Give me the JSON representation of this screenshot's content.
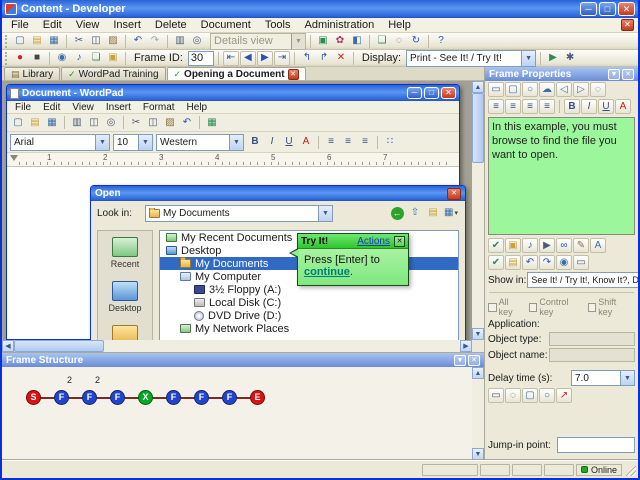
{
  "window": {
    "title": "Content - Developer"
  },
  "menubar": {
    "items": [
      "File",
      "Edit",
      "View",
      "Insert",
      "Delete",
      "Document",
      "Tools",
      "Administration",
      "Help"
    ]
  },
  "toolbar1": {
    "left": [
      {
        "name": "new-document-icon",
        "glyph": "▢",
        "color": "#3A6EA5"
      },
      {
        "name": "open-icon",
        "glyph": "▤",
        "color": "#C9A23A"
      },
      {
        "name": "save-icon",
        "glyph": "▦",
        "color": "#3A6EA5"
      },
      {
        "sep": true
      },
      {
        "name": "cut-icon",
        "glyph": "✂",
        "color": "#4A5A78"
      },
      {
        "name": "copy-icon",
        "glyph": "◫",
        "color": "#4A5A78"
      },
      {
        "name": "paste-icon",
        "glyph": "▨",
        "color": "#8A6D3B"
      },
      {
        "sep": true
      },
      {
        "name": "undo-icon",
        "glyph": "↶",
        "color": "#2A52BE"
      },
      {
        "name": "redo-icon",
        "glyph": "↷",
        "color": "#9AA4B8"
      },
      {
        "sep": true
      },
      {
        "name": "print-icon",
        "glyph": "▥",
        "color": "#4A5A78"
      },
      {
        "name": "preview-icon",
        "glyph": "◎",
        "color": "#4A5A78"
      }
    ],
    "details_view": "Details view",
    "right": [
      {
        "name": "properties-icon",
        "glyph": "▣",
        "color": "#2E8B57"
      },
      {
        "name": "color-palette-icon",
        "glyph": "✿",
        "color": "#B03060"
      },
      {
        "name": "insert-frame-icon",
        "glyph": "◧",
        "color": "#3A6EA5"
      },
      {
        "sep": true
      },
      {
        "name": "bubble-icon",
        "glyph": "❑",
        "color": "#2E8B57"
      },
      {
        "name": "magnifier-icon",
        "glyph": "◌",
        "color": "#4A5A78"
      },
      {
        "name": "refresh-icon",
        "glyph": "↻",
        "color": "#2A52BE"
      },
      {
        "sep": true
      },
      {
        "name": "help-icon",
        "glyph": "?",
        "color": "#2A52BE"
      }
    ]
  },
  "toolbar2": {
    "left": [
      {
        "name": "record-icon",
        "glyph": "●",
        "color": "#CC2222"
      },
      {
        "name": "stop-icon",
        "glyph": "■",
        "color": "#444444"
      },
      {
        "sep": true
      },
      {
        "name": "screenshot-icon",
        "glyph": "◉",
        "color": "#3A6EA5"
      },
      {
        "name": "sound-icon",
        "glyph": "♪",
        "color": "#2A52BE"
      },
      {
        "name": "text-bubble-icon",
        "glyph": "❏",
        "color": "#2E8B57"
      },
      {
        "name": "image-icon",
        "glyph": "▣",
        "color": "#C9A23A"
      },
      {
        "sep": true
      }
    ],
    "frame_id_label": "Frame ID:",
    "frame_id_value": "30",
    "nav": [
      {
        "name": "first-frame-button",
        "glyph": "⇤",
        "color": "#2A52BE"
      },
      {
        "name": "previous-frame-button",
        "glyph": "◀",
        "color": "#2A52BE"
      },
      {
        "name": "next-frame-button",
        "glyph": "▶",
        "color": "#2A52BE"
      },
      {
        "name": "last-frame-button",
        "glyph": "⇥",
        "color": "#2A52BE"
      }
    ],
    "mid": [
      {
        "name": "insert-frame-before-icon",
        "glyph": "↰",
        "color": "#2A52BE"
      },
      {
        "name": "insert-frame-after-icon",
        "glyph": "↱",
        "color": "#2A52BE"
      },
      {
        "name": "delete-frame-icon",
        "glyph": "✕",
        "color": "#CC2222"
      },
      {
        "sep": true
      }
    ],
    "display_label": "Display:",
    "display_value": "Print - See It! / Try It!",
    "right": [
      {
        "name": "play-preview-icon",
        "glyph": "▶",
        "color": "#2E8B57"
      },
      {
        "name": "settings-icon",
        "glyph": "✱",
        "color": "#4A5A78"
      }
    ]
  },
  "tabs": [
    {
      "label": "Library",
      "icon": "library"
    },
    {
      "label": "WordPad Training",
      "check": true
    },
    {
      "label": "Opening a Document",
      "check": true,
      "active": true,
      "close": true
    }
  ],
  "wordpad": {
    "title": "Document - WordPad",
    "menu": [
      "File",
      "Edit",
      "View",
      "Insert",
      "Format",
      "Help"
    ],
    "toolbar": [
      {
        "name": "new-document-icon",
        "glyph": "▢",
        "color": "#3A6EA5"
      },
      {
        "name": "open-icon",
        "glyph": "▤",
        "color": "#C9A23A"
      },
      {
        "name": "save-icon",
        "glyph": "▦",
        "color": "#3A6EA5"
      },
      {
        "sep": true
      },
      {
        "name": "print-icon",
        "glyph": "▥",
        "color": "#4A5A78"
      },
      {
        "name": "print-preview-icon",
        "glyph": "◫",
        "color": "#4A5A78"
      },
      {
        "name": "find-icon",
        "glyph": "◎",
        "color": "#4A5A78"
      },
      {
        "sep": true
      },
      {
        "name": "cut-icon",
        "glyph": "✂",
        "color": "#4A5A78"
      },
      {
        "name": "copy-icon",
        "glyph": "◫",
        "color": "#4A5A78"
      },
      {
        "name": "paste-icon",
        "glyph": "▨",
        "color": "#8A6D3B"
      },
      {
        "name": "undo-icon",
        "glyph": "↶",
        "color": "#2A52BE"
      },
      {
        "sep": true
      },
      {
        "name": "datetime-icon",
        "glyph": "▦",
        "color": "#2E8B57"
      }
    ],
    "font_name": "Arial",
    "font_size": "10",
    "font_script": "Western",
    "format_icons": [
      {
        "name": "bold-button",
        "glyph": "B",
        "bold": true
      },
      {
        "name": "italic-button",
        "glyph": "I",
        "italic": true
      },
      {
        "name": "underline-button",
        "glyph": "U",
        "underline": true
      },
      {
        "name": "font-color-icon",
        "glyph": "A",
        "color": "#CC2200"
      },
      {
        "sep": true
      },
      {
        "name": "align-left-icon",
        "glyph": "≡"
      },
      {
        "name": "align-center-icon",
        "glyph": "≡"
      },
      {
        "name": "align-right-icon",
        "glyph": "≡"
      },
      {
        "sep": true
      },
      {
        "name": "bullets-icon",
        "glyph": "∷",
        "color": "#2A52BE"
      }
    ],
    "ruler_numbers": [
      "1",
      "2",
      "3",
      "4",
      "5",
      "6",
      "7"
    ]
  },
  "open_dialog": {
    "title": "Open",
    "look_in_label": "Look in:",
    "look_in_value": "My Documents",
    "toolbar": [
      {
        "name": "back-icon",
        "glyph": "←",
        "circle": true
      },
      {
        "name": "up-folder-icon",
        "glyph": "⇧",
        "color": "#3A6EA5"
      },
      {
        "name": "new-folder-icon",
        "glyph": "▤",
        "color": "#C9A23A"
      },
      {
        "name": "views-icon",
        "glyph": "▦",
        "color": "#3A6EA5",
        "dropdown": true
      }
    ],
    "places": [
      {
        "label": "Recent",
        "icon": "recent"
      },
      {
        "label": "Desktop",
        "icon": "desktop"
      },
      {
        "label": "",
        "icon": "folder"
      }
    ],
    "tree": [
      {
        "label": "My Recent Documents",
        "depth": 0,
        "icon": "recent"
      },
      {
        "label": "Desktop",
        "depth": 0,
        "icon": "desktop"
      },
      {
        "label": "My Documents",
        "depth": 1,
        "icon": "folder",
        "selected": true
      },
      {
        "label": "My Computer",
        "depth": 1,
        "icon": "computer"
      },
      {
        "label": "3½ Floppy (A:)",
        "depth": 2,
        "icon": "floppy"
      },
      {
        "label": "Local Disk (C:)",
        "depth": 2,
        "icon": "disk"
      },
      {
        "label": "DVD Drive (D:)",
        "depth": 2,
        "icon": "dvd"
      },
      {
        "label": "My Network Places",
        "depth": 1,
        "icon": "network"
      }
    ]
  },
  "try_it": {
    "title": "Try It!",
    "actions_label": "Actions",
    "body_prefix": "Press [Enter] to ",
    "link_text": "continue",
    "body_suffix": "."
  },
  "frame_properties": {
    "title": "Frame Properties",
    "bubble_styles": [
      {
        "name": "rectangle-bubble-icon",
        "glyph": "▭",
        "color": "#3A6EA5"
      },
      {
        "name": "rounded-bubble-icon",
        "glyph": "▢",
        "color": "#3A6EA5"
      },
      {
        "name": "oval-bubble-icon",
        "glyph": "○",
        "color": "#3A6EA5"
      },
      {
        "name": "cloud-bubble-icon",
        "glyph": "☁",
        "color": "#3A6EA5"
      },
      {
        "name": "left-pointer-bubble-icon",
        "glyph": "◁",
        "color": "#3A6EA5"
      },
      {
        "name": "right-pointer-bubble-icon",
        "glyph": "▷",
        "color": "#3A6EA5"
      },
      {
        "name": "no-bubble-icon",
        "glyph": "◌",
        "color": "#3A6EA5"
      }
    ],
    "format_icons": [
      {
        "name": "align-left-icon",
        "glyph": "≡"
      },
      {
        "name": "align-center-icon",
        "glyph": "≡"
      },
      {
        "name": "align-right-icon",
        "glyph": "≡"
      },
      {
        "name": "justify-icon",
        "glyph": "≡"
      },
      {
        "sep": true
      },
      {
        "name": "bold-button",
        "glyph": "B",
        "bold": true
      },
      {
        "name": "italic-button",
        "glyph": "I",
        "italic": true
      },
      {
        "name": "underline-button",
        "glyph": "U",
        "underline": true
      },
      {
        "name": "font-color-icon",
        "glyph": "A",
        "color": "#CC2200"
      }
    ],
    "bubble_text": "In this example, you must browse to find the file you want to open.",
    "icons_row1": [
      {
        "name": "spellcheck-icon",
        "glyph": "✔",
        "color": "#2E8B57"
      },
      {
        "name": "insert-image-icon",
        "glyph": "▣",
        "color": "#C9A23A"
      },
      {
        "name": "insert-sound-icon",
        "glyph": "♪",
        "color": "#2A52BE"
      },
      {
        "name": "insert-video-icon",
        "glyph": "▶",
        "color": "#4A5A78"
      },
      {
        "name": "insert-link-icon",
        "glyph": "∞",
        "color": "#2A52BE"
      },
      {
        "name": "edit-text-icon",
        "glyph": "✎",
        "color": "#8A6D3B"
      },
      {
        "name": "font-icon",
        "glyph": "A",
        "color": "#3A6EA5"
      }
    ],
    "icons_row2": [
      {
        "name": "apply-icon",
        "glyph": "✔",
        "color": "#2E8B57"
      },
      {
        "name": "open-folder-icon",
        "glyph": "▤",
        "color": "#C9A23A"
      },
      {
        "name": "previous-object-icon",
        "glyph": "↶",
        "color": "#2A52BE"
      },
      {
        "name": "next-object-icon",
        "glyph": "↷",
        "color": "#2A52BE"
      },
      {
        "name": "capture-object-icon",
        "glyph": "◉",
        "color": "#3A6EA5"
      },
      {
        "name": "keyboard-icon",
        "glyph": "▭",
        "color": "#4A5A78"
      }
    ],
    "show_in_label": "Show in:",
    "show_in_value": "See It! / Try It!, Know It?, Do It!",
    "checkboxes": [
      {
        "label": "All key"
      },
      {
        "label": "Control key"
      },
      {
        "label": "Shift key"
      }
    ],
    "application_label": "Application:",
    "object_type_label": "Object type:",
    "object_name_label": "Object name:",
    "delay_label": "Delay time (s):",
    "delay_value": "7.0",
    "delay_icons": [
      {
        "name": "keystroke-icon",
        "glyph": "▭",
        "color": "#4A5A78"
      },
      {
        "name": "mouse-click-icon",
        "glyph": "◌",
        "color": "#4A5A78"
      },
      {
        "name": "rectangle-tool-icon",
        "glyph": "▢",
        "color": "#3A6EA5"
      },
      {
        "name": "circle-tool-icon",
        "glyph": "○",
        "color": "#3A6EA5"
      },
      {
        "name": "arrow-tool-icon",
        "glyph": "↗",
        "color": "#CC2222"
      }
    ],
    "jump_in_label": "Jump-in point:"
  },
  "frame_structure": {
    "title": "Frame Structure",
    "nodes": [
      {
        "label": "S",
        "color": "#DD1111",
        "sup": ""
      },
      {
        "label": "F",
        "color": "#2244CC",
        "sup": "2"
      },
      {
        "label": "F",
        "color": "#2244CC",
        "sup": "2"
      },
      {
        "label": "F",
        "color": "#2244CC",
        "sup": ""
      },
      {
        "label": "X",
        "color": "#00AA22",
        "sup": ""
      },
      {
        "label": "F",
        "color": "#2244CC",
        "sup": ""
      },
      {
        "label": "F",
        "color": "#2244CC",
        "sup": ""
      },
      {
        "label": "F",
        "color": "#2244CC",
        "sup": ""
      },
      {
        "label": "E",
        "color": "#DD1111",
        "sup": ""
      }
    ]
  },
  "statusbar": {
    "cells": [
      "",
      "",
      "",
      ""
    ],
    "online": "Online"
  }
}
